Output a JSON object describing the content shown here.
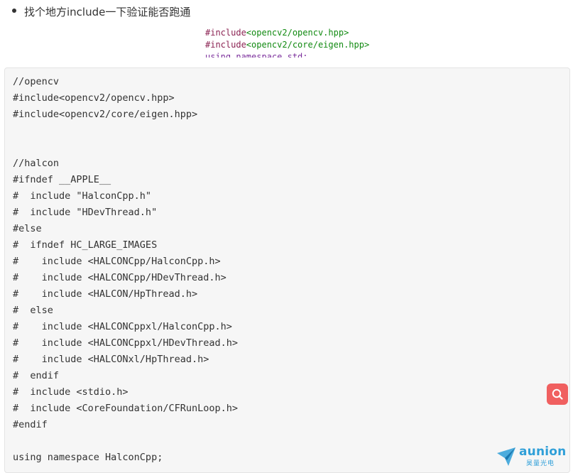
{
  "bullet": {
    "text": "找个地方include一下验证能否跑通"
  },
  "snippet": {
    "line1_kw": "#include",
    "line1_hdr": "<opencv2/opencv.hpp>",
    "line2_kw": "#include",
    "line2_hdr": "<opencv2/core/eigen.hpp>",
    "line3_partial": "using namespace std;"
  },
  "code": {
    "lines": [
      "//opencv",
      "#include<opencv2/opencv.hpp>",
      "#include<opencv2/core/eigen.hpp>",
      "",
      "",
      "//halcon",
      "#ifndef __APPLE__",
      "#  include \"HalconCpp.h\"",
      "#  include \"HDevThread.h\"",
      "#else",
      "#  ifndef HC_LARGE_IMAGES",
      "#    include <HALCONCpp/HalconCpp.h>",
      "#    include <HALCONCpp/HDevThread.h>",
      "#    include <HALCON/HpThread.h>",
      "#  else",
      "#    include <HALCONCppxl/HalconCpp.h>",
      "#    include <HALCONCppxl/HDevThread.h>",
      "#    include <HALCONxl/HpThread.h>",
      "#  endif",
      "#  include <stdio.h>",
      "#  include <CoreFoundation/CFRunLoop.h>",
      "#endif",
      "",
      "using namespace HalconCpp;"
    ]
  },
  "search_button": {
    "icon": "search-icon",
    "color": "#f06060"
  },
  "watermark": {
    "brand": "aunion",
    "sub": "昊量光电",
    "color": "#2f9fd8"
  }
}
